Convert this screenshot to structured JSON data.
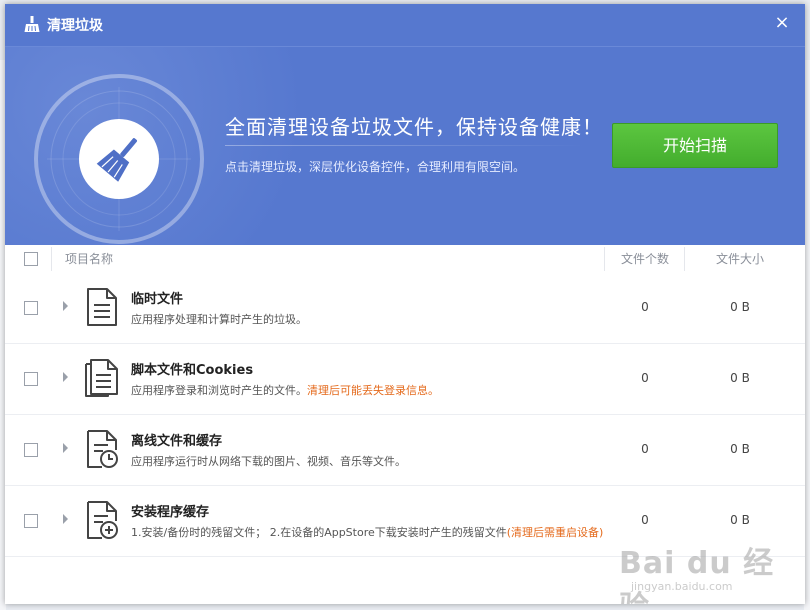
{
  "window": {
    "title": "清理垃圾",
    "close_glyph": "×"
  },
  "banner": {
    "headline": "全面清理设备垃圾文件，保持设备健康！",
    "subline": "点击清理垃圾，深层优化设备控件，合理利用有限空间。",
    "start_button": "开始扫描",
    "icon": "broom-icon"
  },
  "table": {
    "columns": {
      "name": "项目名称",
      "count": "文件个数",
      "size": "文件大小"
    },
    "rows": [
      {
        "name": "临时文件",
        "desc": "应用程序处理和计算时产生的垃圾。",
        "warn": "",
        "count": "0",
        "size": "0 B",
        "icon": "document-icon"
      },
      {
        "name": "脚本文件和Cookies",
        "desc": "应用程序登录和浏览时产生的文件。",
        "warn": "清理后可能丢失登录信息。",
        "count": "0",
        "size": "0 B",
        "icon": "documents-stack-icon"
      },
      {
        "name": "离线文件和缓存",
        "desc": "应用程序运行时从网络下载的图片、视频、音乐等文件。",
        "warn": "",
        "count": "0",
        "size": "0 B",
        "icon": "document-clock-icon"
      },
      {
        "name": "安装程序缓存",
        "desc": "1.安装/备份时的残留文件； 2.在设备的AppStore下载安装时产生的残留文件",
        "warn": "(清理后需重启设备)",
        "count": "0",
        "size": "0 B",
        "icon": "document-add-icon"
      }
    ]
  },
  "watermark": {
    "main": "Bai du 经验",
    "sub": "jingyan.baidu.com"
  },
  "colors": {
    "title_blue": "#5678cf",
    "button_green": "#4db533",
    "warning_orange": "#e46a1c"
  }
}
